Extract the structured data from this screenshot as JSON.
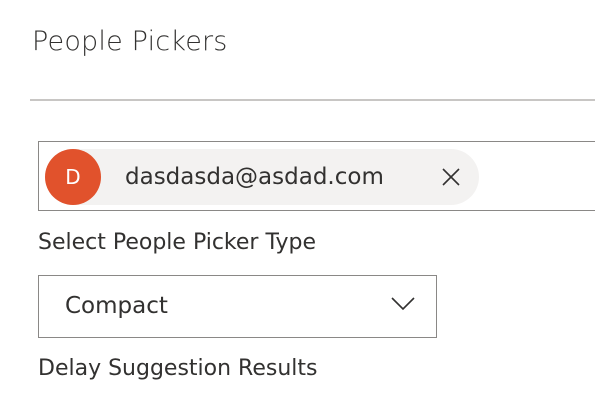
{
  "page": {
    "title": "People Pickers"
  },
  "picker": {
    "persona": {
      "initials": "D",
      "email": "dasdasda@asdad.com",
      "avatar_color": "#e1522c",
      "remove_icon": "close-icon"
    }
  },
  "picker_type": {
    "label": "Select People Picker Type",
    "selected": "Compact",
    "icon": "chevron-down-icon"
  },
  "delay": {
    "label": "Delay Suggestion Results"
  }
}
